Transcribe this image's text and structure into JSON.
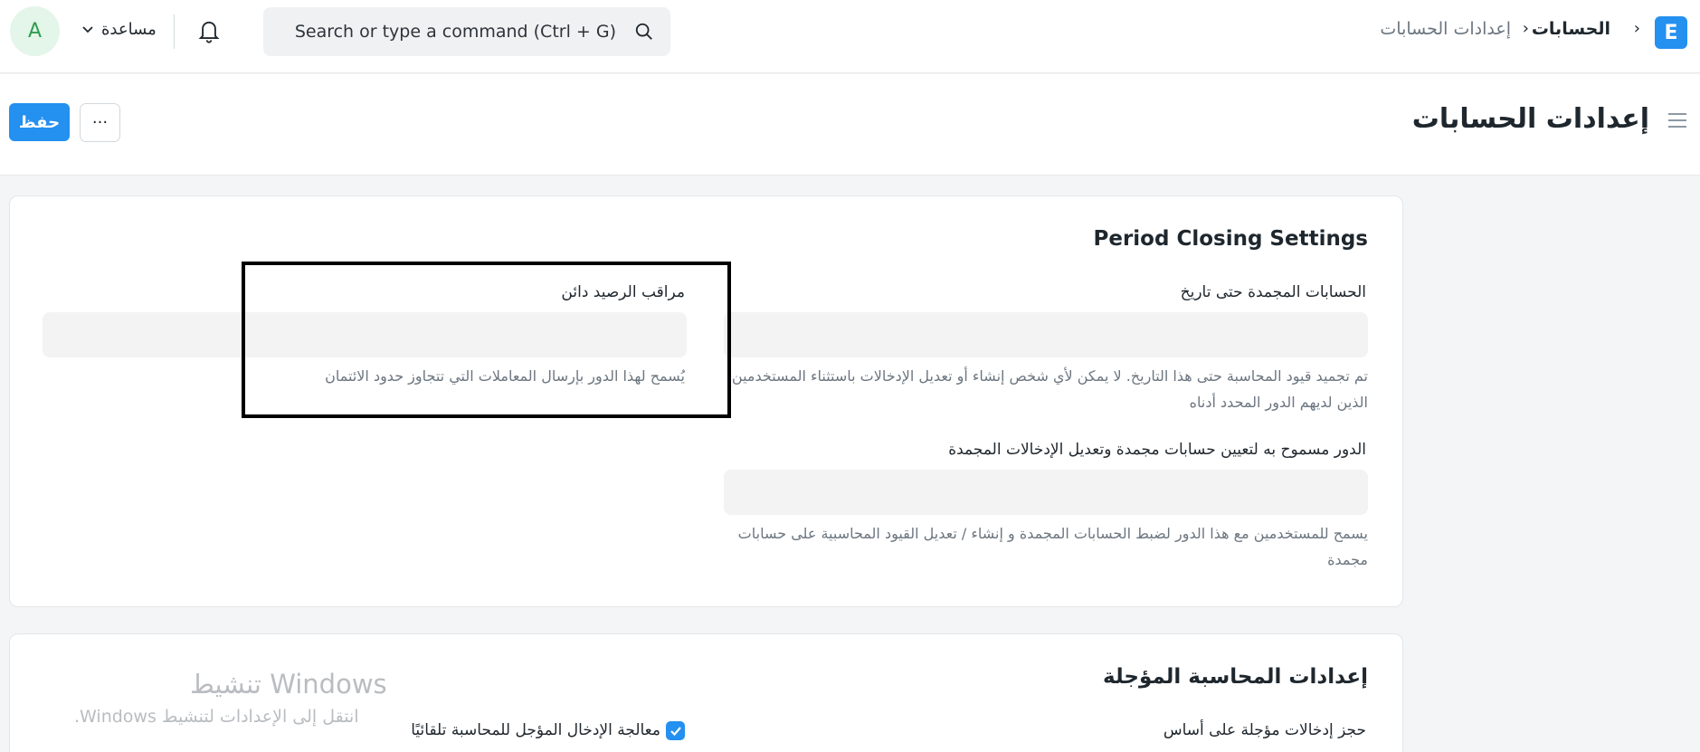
{
  "topbar": {
    "logo_letter": "E",
    "breadcrumb": {
      "separator": "›",
      "items": [
        "الحسابات",
        "إعدادات الحسابات"
      ]
    },
    "search": {
      "placeholder": "Search or type a command (Ctrl + G)"
    },
    "help_label": "مساعدة",
    "avatar_initial": "A"
  },
  "page": {
    "title": "إعدادات الحسابات",
    "save_label": "حفظ",
    "more_label": "···"
  },
  "sections": {
    "period_closing": {
      "title": "Period Closing Settings",
      "frozen_until": {
        "label": "الحسابات المجمدة حتى تاريخ",
        "value": "",
        "description": "تم تجميد قيود المحاسبة حتى هذا التاريخ. لا يمكن لأي شخص إنشاء أو تعديل الإدخالات باستثناء المستخدمين الذين لديهم الدور المحدد أدناه"
      },
      "credit_controller": {
        "label": "مراقب الرصيد دائن",
        "value": "",
        "description": "يُسمح لهذا الدور بإرسال المعاملات التي تتجاوز حدود الائتمان"
      },
      "frozen_role": {
        "label": "الدور مسموح به لتعيين حسابات مجمدة وتعديل الإدخالات المجمدة",
        "value": "",
        "description": "يسمح للمستخدمين مع هذا الدور لضبط الحسابات المجمدة و إنشاء / تعديل القيود المحاسبية على حسابات مجمدة"
      }
    },
    "deferred_accounting": {
      "title": "إعدادات المحاسبة المؤجلة",
      "book_deferred_label": "حجز إدخالات مؤجلة على أساس",
      "auto_process_label": "معالجة الإدخال المؤجل للمحاسبة تلقائيًا",
      "auto_process_checked": true
    }
  },
  "watermark": {
    "title": "تنشيط Windows",
    "subtitle": "انتقل إلى الإعدادات لتنشيط Windows."
  },
  "colors": {
    "primary": "#2490ef",
    "avatar_bg": "#e4f5e9",
    "avatar_fg": "#2e9e4f"
  }
}
